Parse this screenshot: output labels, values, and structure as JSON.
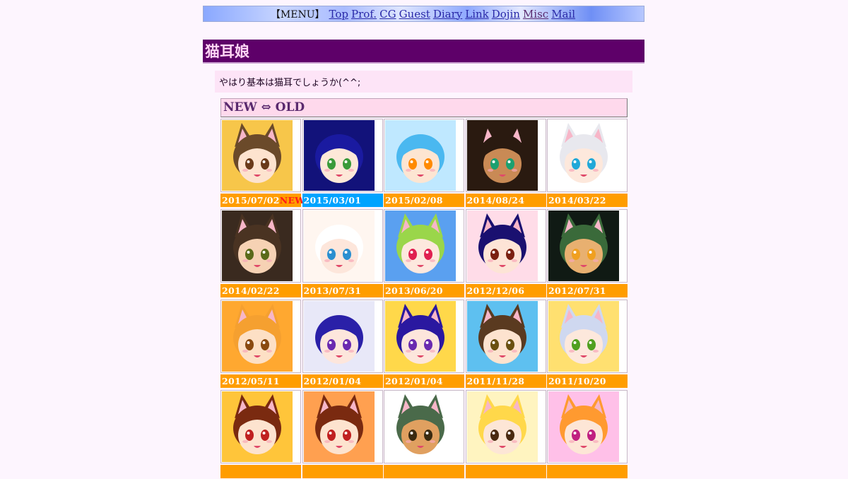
{
  "menu": {
    "label": "【MENU】",
    "links": [
      {
        "label": "Top",
        "visited": false
      },
      {
        "label": "Prof.",
        "visited": false
      },
      {
        "label": "CG",
        "visited": false
      },
      {
        "label": "Guest",
        "visited": false
      },
      {
        "label": "Diary",
        "visited": false
      },
      {
        "label": "Link",
        "visited": false
      },
      {
        "label": "Dojin",
        "visited": false
      },
      {
        "label": "Misc",
        "visited": true
      },
      {
        "label": "Mail",
        "visited": false
      }
    ]
  },
  "section": {
    "title": "猫耳娘"
  },
  "intro": {
    "text": "やはり基本は猫耳でしょうか(^^;"
  },
  "gallery": {
    "header": "NEW ⇔ OLD",
    "new_badge": "NEW",
    "items": [
      {
        "date": "2015/07/02",
        "new": true,
        "label_color": "orange",
        "bg": "#f7c64a",
        "hair": "#6b4a2a",
        "eye": "#6a3a1a",
        "skin": "#fde3cf",
        "ears": true
      },
      {
        "date": "2015/03/01",
        "new": false,
        "label_color": "blue",
        "bg": "#12127a",
        "hair": "#1a1aa0",
        "eye": "#3a9a3a",
        "skin": "#fde8d8",
        "ears": false
      },
      {
        "date": "2015/02/08",
        "new": false,
        "label_color": "orange",
        "bg": "#bfe8ff",
        "hair": "#4ab8f0",
        "eye": "#ff8a00",
        "skin": "#fde5d2",
        "ears": false
      },
      {
        "date": "2014/08/24",
        "new": false,
        "label_color": "orange",
        "bg": "#2a1a10",
        "hair": "#2a1a10",
        "eye": "#1aa070",
        "skin": "#c98a55",
        "ears": true
      },
      {
        "date": "2014/03/22",
        "new": false,
        "label_color": "orange",
        "bg": "#ffffff",
        "hair": "#e8e8ee",
        "eye": "#20a8d8",
        "skin": "#fde8dc",
        "ears": true
      },
      {
        "date": "2014/02/22",
        "new": false,
        "label_color": "orange",
        "bg": "#3a2a1f",
        "hair": "#4a3322",
        "eye": "#5a6a1a",
        "skin": "#f6d2b4",
        "ears": true
      },
      {
        "date": "2013/07/31",
        "new": false,
        "label_color": "orange",
        "bg": "#fff6f0",
        "hair": "#ffffff",
        "eye": "#2a8fd0",
        "skin": "#fde6db",
        "ears": false
      },
      {
        "date": "2013/06/20",
        "new": false,
        "label_color": "orange",
        "bg": "#5aa0f0",
        "hair": "#9ad64a",
        "eye": "#e02050",
        "skin": "#fde8de",
        "ears": true
      },
      {
        "date": "2012/12/06",
        "new": false,
        "label_color": "orange",
        "bg": "#ffdce8",
        "hair": "#1a1070",
        "eye": "#7a2010",
        "skin": "#fde4d6",
        "ears": true
      },
      {
        "date": "2012/07/31",
        "new": false,
        "label_color": "orange",
        "bg": "#101a14",
        "hair": "#3a6a3a",
        "eye": "#f0a020",
        "skin": "#e8b070",
        "ears": true
      },
      {
        "date": "2012/05/11",
        "new": false,
        "label_color": "orange",
        "bg": "#ffa830",
        "hair": "#f5a030",
        "eye": "#8a4a10",
        "skin": "#fde0c5",
        "ears": true
      },
      {
        "date": "2012/01/04",
        "new": false,
        "label_color": "orange",
        "bg": "#e8e8f8",
        "hair": "#2a20a8",
        "eye": "#6a2ab0",
        "skin": "#fde6dc",
        "ears": false
      },
      {
        "date": "2012/01/04",
        "new": false,
        "label_color": "orange",
        "bg": "#ffd84a",
        "hair": "#2a18a0",
        "eye": "#6a2ab0",
        "skin": "#fde6dc",
        "ears": true
      },
      {
        "date": "2011/11/28",
        "new": false,
        "label_color": "orange",
        "bg": "#5ec0f0",
        "hair": "#5a3a20",
        "eye": "#6a5010",
        "skin": "#fde3cf",
        "ears": true
      },
      {
        "date": "2011/10/20",
        "new": false,
        "label_color": "orange",
        "bg": "#ffe070",
        "hair": "#cfd8f0",
        "eye": "#50a020",
        "skin": "#fde8dc",
        "ears": true
      },
      {
        "date": "",
        "new": false,
        "label_color": "orange",
        "bg": "#ffc53a",
        "hair": "#7a2a10",
        "eye": "#c02020",
        "skin": "#fde3cf",
        "ears": true
      },
      {
        "date": "",
        "new": false,
        "label_color": "orange",
        "bg": "#ffa050",
        "hair": "#7a2a10",
        "eye": "#c02020",
        "skin": "#fde3cf",
        "ears": true
      },
      {
        "date": "",
        "new": false,
        "label_color": "orange",
        "bg": "#ffffff",
        "hair": "#4a6a4a",
        "eye": "#3a2a10",
        "skin": "#e0a060",
        "ears": true
      },
      {
        "date": "",
        "new": false,
        "label_color": "orange",
        "bg": "#fff4c0",
        "hair": "#ffd84a",
        "eye": "#4a2a10",
        "skin": "#fde6d6",
        "ears": true
      },
      {
        "date": "",
        "new": false,
        "label_color": "orange",
        "bg": "#ffc0e8",
        "hair": "#ff9a30",
        "eye": "#c02080",
        "skin": "#fde6d6",
        "ears": true
      }
    ]
  }
}
